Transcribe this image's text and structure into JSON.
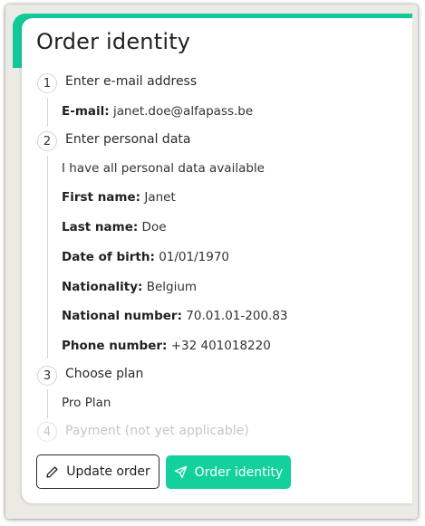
{
  "card": {
    "title": "Order identity"
  },
  "steps": [
    {
      "number": "1",
      "label": "Enter e-mail address"
    },
    {
      "number": "2",
      "label": "Enter personal data"
    },
    {
      "number": "3",
      "label": "Choose plan"
    },
    {
      "number": "4",
      "label": "Payment (not yet applicable)"
    }
  ],
  "email": {
    "label": "E-mail:",
    "value": "janet.doe@alfapass.be"
  },
  "personal": {
    "note": "I have all personal data available",
    "first_name": {
      "label": "First name:",
      "value": "Janet"
    },
    "last_name": {
      "label": "Last name:",
      "value": "Doe"
    },
    "dob": {
      "label": "Date of birth:",
      "value": "01/01/1970"
    },
    "nationality": {
      "label": "Nationality:",
      "value": "Belgium"
    },
    "national_number": {
      "label": "National number:",
      "value": "70.01.01-200.83"
    },
    "phone": {
      "label": "Phone number:",
      "value": "+32 401018220"
    }
  },
  "plan": {
    "value": "Pro Plan"
  },
  "actions": {
    "update_label": "Update order",
    "order_label": "Order identity"
  },
  "colors": {
    "accent": "#12c99a",
    "primary_button": "#12d19c",
    "frame_background": "#eceae4"
  },
  "icons": {
    "update": "pencil-icon",
    "order": "send-icon"
  }
}
